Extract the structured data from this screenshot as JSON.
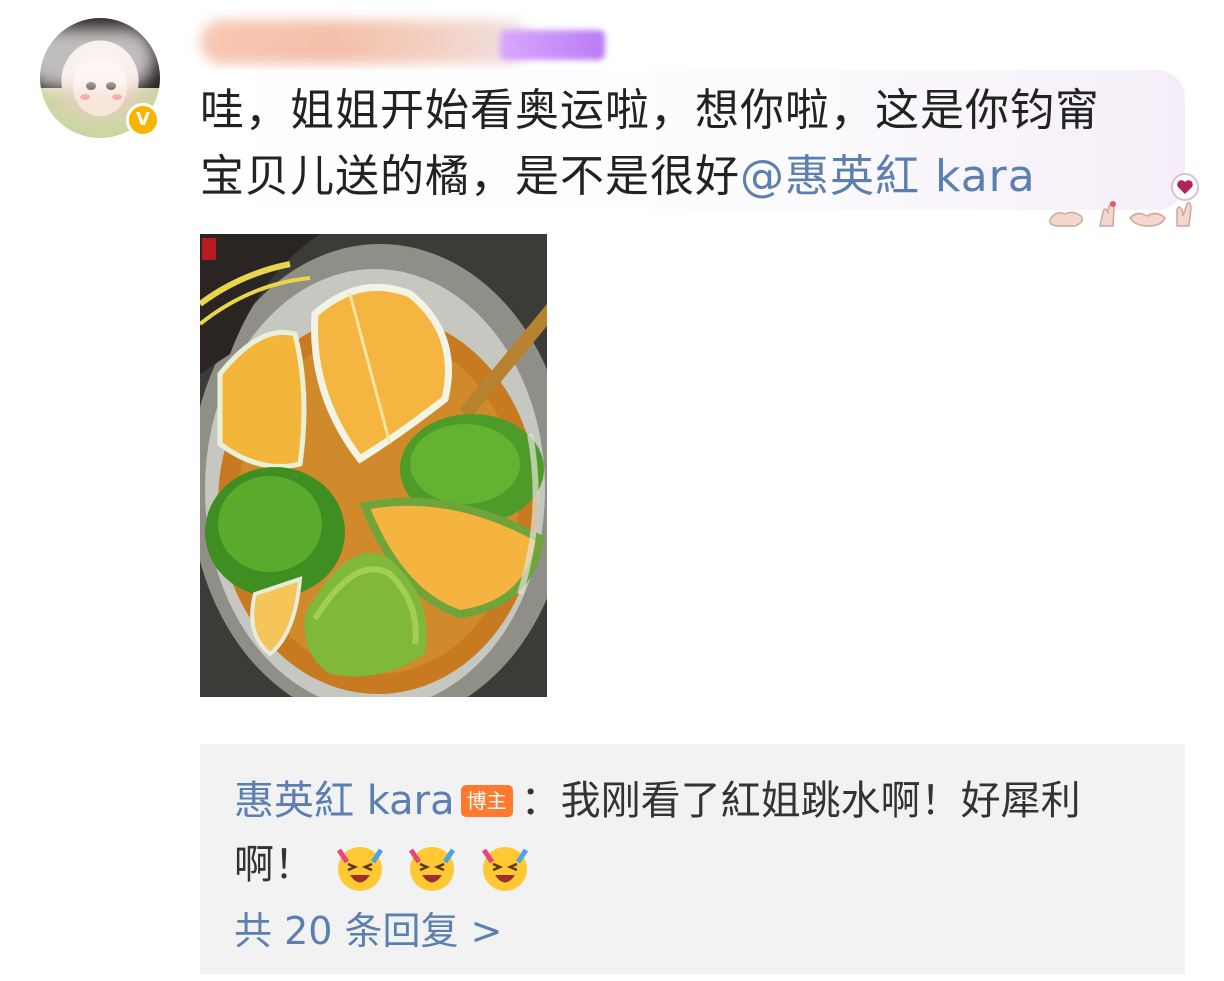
{
  "comment": {
    "text_line1": "哇，姐姐开始看奥运啦，想你啦，这是你钧甯",
    "text_line2": "宝贝儿送的橘，是不是很好",
    "mention": "@惠英紅 kara"
  },
  "reply": {
    "author": "惠英紅 kara",
    "badge": "博主",
    "separator": "：",
    "text_line1": "我刚看了紅姐跳水啊！好犀利",
    "text_line2": "啊！"
  },
  "more_replies": {
    "label": "共 20 条回复 >"
  },
  "colors": {
    "link": "#5b7fb0",
    "badge_orange": "#ff7a2e",
    "verified_gold": "#f7b500",
    "reply_bg": "#f2f2f2"
  },
  "icons": [
    "verified-icon",
    "laughing-emoji-icon",
    "hand-gesture-decoration-icon",
    "heart-icon"
  ]
}
